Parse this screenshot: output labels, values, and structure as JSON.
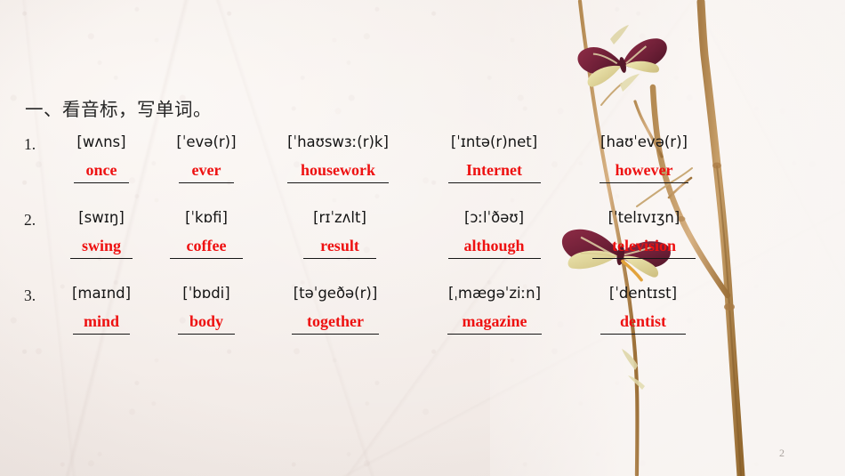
{
  "slide": {
    "title": "一、看音标，写单词。",
    "page_number": "2",
    "answer_color": "#ee1111",
    "text_color": "#141414",
    "background_color": "#f4eeea"
  },
  "rows": [
    {
      "number": "1.",
      "items": [
        {
          "ipa": "[wʌns]",
          "answer": "once"
        },
        {
          "ipa": "[ˈevə(r)]",
          "answer": "ever"
        },
        {
          "ipa": "[ˈhaʊswɜː(r)k]",
          "answer": "housework"
        },
        {
          "ipa": "[ˈɪntə(r)net]",
          "answer": "Internet"
        },
        {
          "ipa": "[haʊˈevə(r)]",
          "answer": "however"
        }
      ]
    },
    {
      "number": "2.",
      "items": [
        {
          "ipa": "[swɪŋ]",
          "answer": "swing"
        },
        {
          "ipa": "[ˈkɒfi]",
          "answer": "coffee"
        },
        {
          "ipa": "[rɪˈzʌlt]",
          "answer": "result"
        },
        {
          "ipa": "[ɔːlˈðəʊ]",
          "answer": "although"
        },
        {
          "ipa": "[ˈtelɪvɪʒn]",
          "answer": "television"
        }
      ]
    },
    {
      "number": "3.",
      "items": [
        {
          "ipa": "[maɪnd]",
          "answer": "mind"
        },
        {
          "ipa": "[ˈbɒdi]",
          "answer": "body"
        },
        {
          "ipa": "[təˈgeðə(r)]",
          "answer": "together"
        },
        {
          "ipa": "[ˌmægəˈziːn]",
          "answer": "magazine"
        },
        {
          "ipa": "[ˈdentɪst]",
          "answer": "dentist"
        }
      ]
    }
  ],
  "decorations": {
    "branch_color": "#b99058",
    "butterfly_wing_color": "#7d2340",
    "butterfly_accent_color": "#e8e2a8"
  }
}
